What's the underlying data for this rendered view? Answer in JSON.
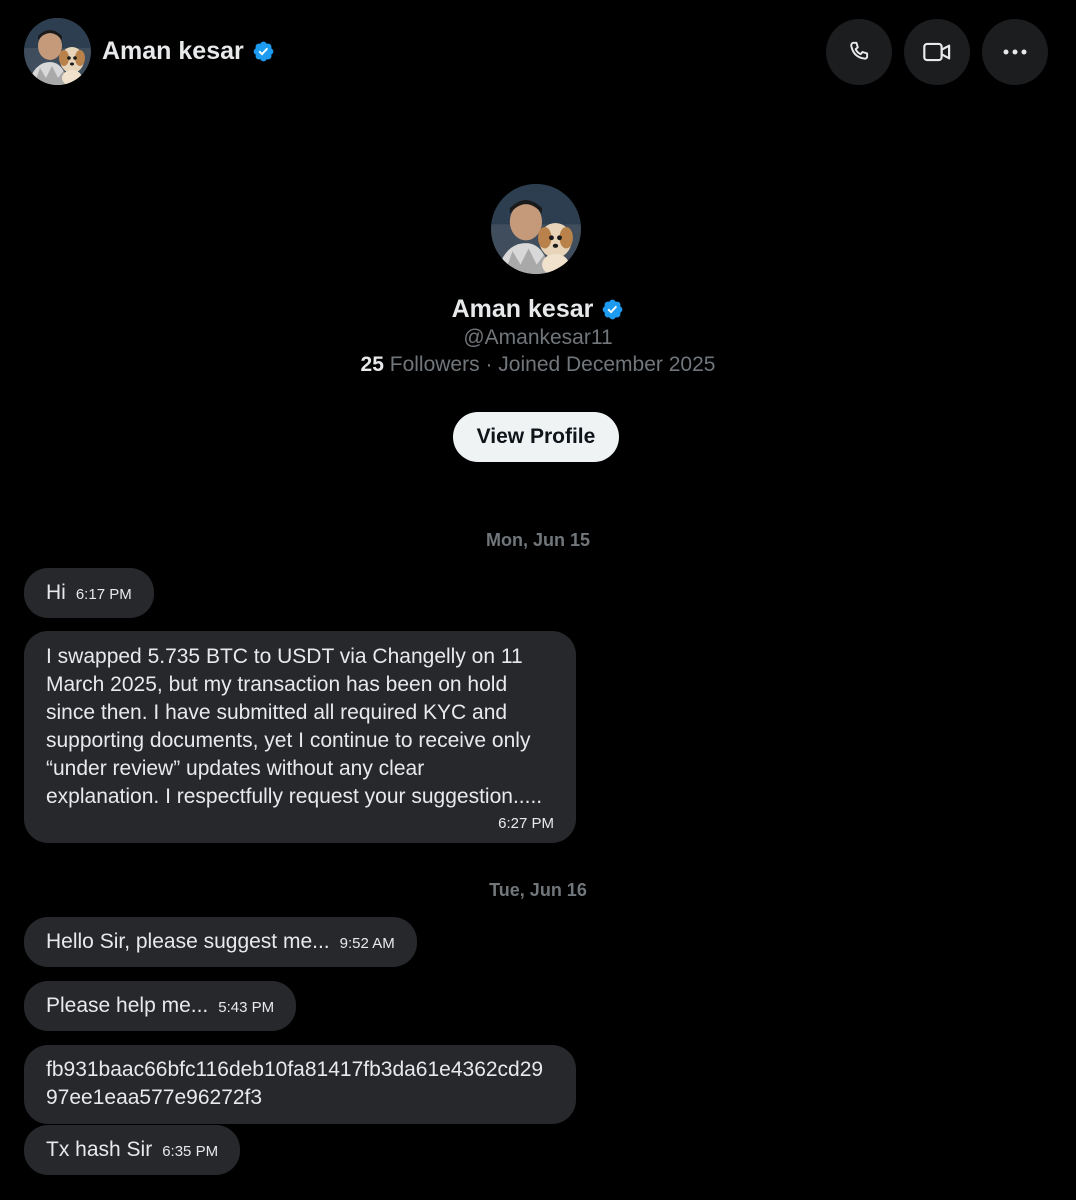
{
  "header": {
    "name": "Aman kesar",
    "call_icon": "phone-icon",
    "video_icon": "video-icon",
    "more_icon": "more-icon"
  },
  "profile": {
    "name": "Aman kesar",
    "handle": "@Amankesar11",
    "followers_count": "25",
    "followers_label": "Followers",
    "separator": "·",
    "joined": "Joined December 2025",
    "view_profile_label": "View Profile"
  },
  "colors": {
    "background": "#000000",
    "bubble": "#26282b",
    "verified": "#1d9bf0",
    "button": "#eff3f4",
    "muted": "#71767b"
  },
  "conversation": {
    "date1": "Mon, Jun 15",
    "date2": "Tue, Jun 16",
    "messages": [
      {
        "text": "Hi",
        "time": "6:17 PM"
      },
      {
        "text": "I swapped 5.735 BTC to USDT via Changelly on 11\nMarch 2025, but my transaction has been on hold\nsince then. I have submitted all required KYC and\nsupporting documents, yet I continue to receive only\n“under review” updates without any clear\nexplanation. I respectfully request your suggestion.....",
        "time": "6:27 PM"
      },
      {
        "text": "Hello Sir, please suggest me...",
        "time": "9:52 AM"
      },
      {
        "text": "Please help me...",
        "time": "5:43 PM"
      },
      {
        "text": "fb931baac66bfc116deb10fa81417fb3da61e4362cd29\n97ee1eaa577e96272f3",
        "time": ""
      },
      {
        "text": "Tx hash Sir",
        "time": "6:35 PM"
      }
    ]
  }
}
